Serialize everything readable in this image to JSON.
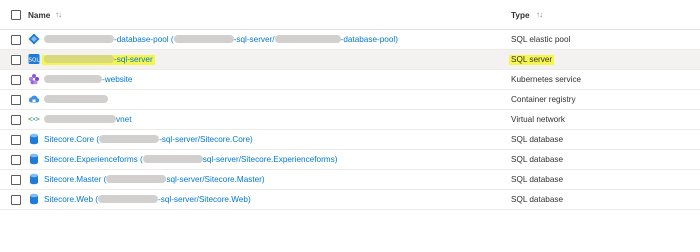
{
  "header": {
    "name_label": "Name",
    "type_label": "Type",
    "sort_glyph_name": "↑↓",
    "sort_glyph_type": "↑↓"
  },
  "rows": [
    {
      "name_pre": "",
      "name_a": "-database-pool",
      "name_b": " (",
      "name_c": "-sql-server/",
      "name_d": "-database-pool)",
      "type": "SQL elastic pool",
      "icon": "elastic-pool-icon"
    },
    {
      "name_a": "-sql-server",
      "type": "SQL server",
      "icon": "sql-server-icon"
    },
    {
      "name_a": "-website",
      "type": "Kubernetes service",
      "icon": "kubernetes-icon"
    },
    {
      "name_a": "",
      "type": "Container registry",
      "icon": "container-registry-icon"
    },
    {
      "name_a": "vnet",
      "type": "Virtual network",
      "icon": "virtual-network-icon"
    },
    {
      "name_pre": "Sitecore.Core (",
      "name_a": "-sql-server/Sitecore.Core)",
      "type": "SQL database",
      "icon": "sql-database-icon"
    },
    {
      "name_pre": "Sitecore.Experienceforms (",
      "name_a": "sql-server/Sitecore.Experienceforms)",
      "type": "SQL database",
      "icon": "sql-database-icon"
    },
    {
      "name_pre": "Sitecore.Master (",
      "name_a": "sql-server/Sitecore.Master)",
      "type": "SQL database",
      "icon": "sql-database-icon"
    },
    {
      "name_pre": "Sitecore.Web (",
      "name_a": "-sql-server/Sitecore.Web)",
      "type": "SQL database",
      "icon": "sql-database-icon"
    }
  ],
  "colors": {
    "link": "#0078d4",
    "highlight": "#f6f54b",
    "selected_row": "#f3f2f1"
  }
}
